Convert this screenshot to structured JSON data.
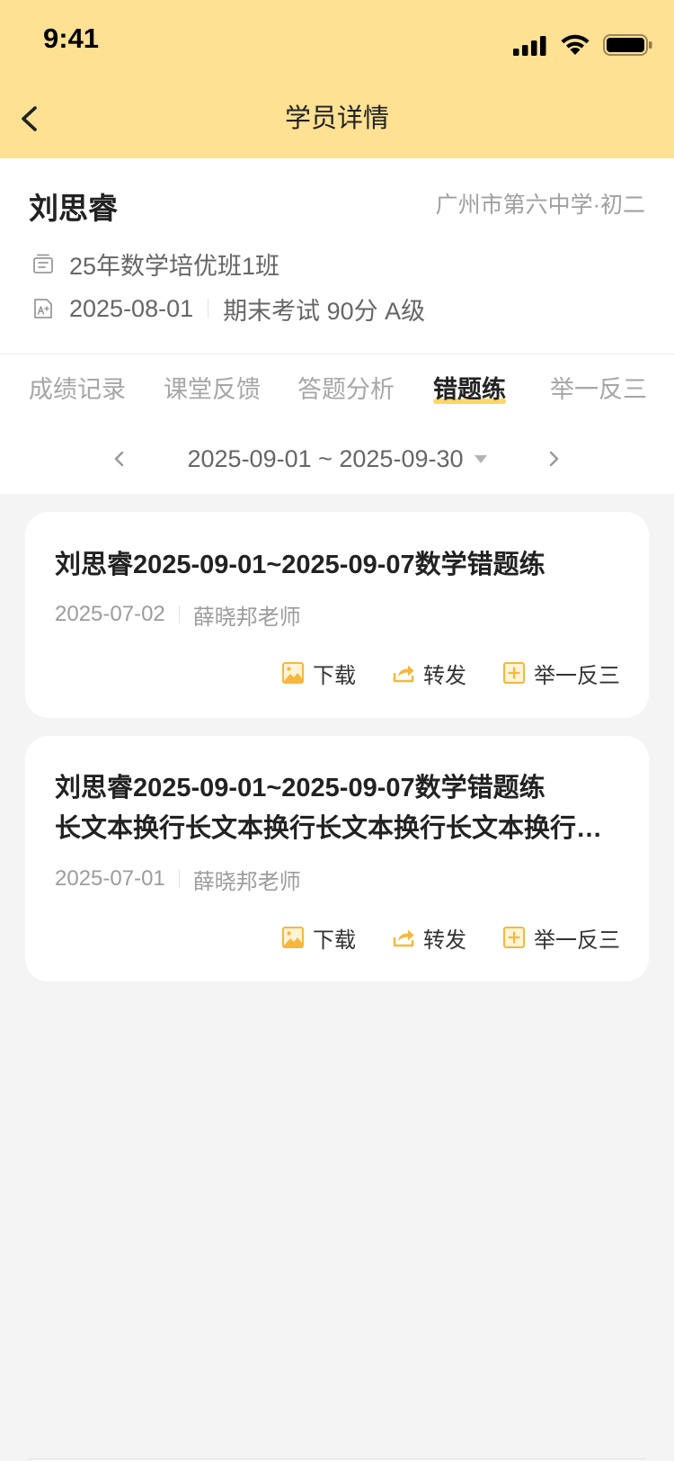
{
  "status_bar": {
    "time": "9:41",
    "icons": [
      "signal-icon",
      "wifi-icon",
      "battery-icon"
    ]
  },
  "header": {
    "title": "学员详情",
    "back_icon": "chevron-left-icon"
  },
  "student": {
    "name": "刘思睿",
    "school": "广州市第六中学·初二",
    "class_name": "25年数学培优班1班",
    "exam_date": "2025-08-01",
    "exam_result": "期末考试 90分 A级"
  },
  "tabs": [
    {
      "label": "成绩记录",
      "active": false
    },
    {
      "label": "课堂反馈",
      "active": false
    },
    {
      "label": "答题分析",
      "active": false
    },
    {
      "label": "错题练",
      "active": true
    },
    {
      "label": "举一反三",
      "active": false
    }
  ],
  "date_range": {
    "label": "2025-09-01 ~ 2025-09-30"
  },
  "items": [
    {
      "title_lines": [
        "刘思睿2025-09-01~2025-09-07数学错题练"
      ],
      "date": "2025-07-02",
      "teacher": "薛晓邦老师"
    },
    {
      "title_lines": [
        "刘思睿2025-09-01~2025-09-07数学错题练",
        "长文本换行长文本换行长文本换行长文本换行…"
      ],
      "date": "2025-07-01",
      "teacher": "薛晓邦老师"
    }
  ],
  "actions": {
    "download": "下载",
    "share": "转发",
    "similar": "举一反三"
  },
  "icons": {
    "class": "class-icon",
    "exam": "exam-grade-icon",
    "download": "image-download-icon",
    "share": "share-arrow-icon",
    "similar": "plus-square-icon"
  },
  "colors": {
    "header_bg": "#FFE194",
    "accent": "#F6B73C",
    "tab_indicator": "#FFD664",
    "page_bg": "#F4F4F4",
    "text_primary": "#222222",
    "text_secondary": "#999999"
  }
}
